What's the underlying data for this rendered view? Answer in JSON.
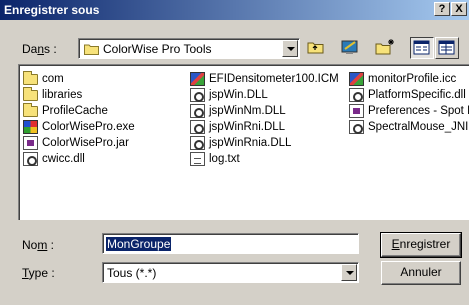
{
  "window": {
    "title": "Enregistrer sous",
    "help_glyph": "?",
    "close_glyph": "X"
  },
  "lookin": {
    "label_prefix": "Da",
    "label_accel": "n",
    "label_suffix": "s :",
    "value": "ColorWise Pro Tools"
  },
  "toolbar": {
    "icons": [
      "up-folder-icon",
      "desktop-icon",
      "new-folder-icon",
      "list-view-icon",
      "details-view-icon"
    ]
  },
  "files": {
    "col1": [
      {
        "name": "com",
        "icon": "folder-icon"
      },
      {
        "name": "libraries",
        "icon": "folder-icon"
      },
      {
        "name": "ProfileCache",
        "icon": "folder-icon"
      },
      {
        "name": "ColorWisePro.exe",
        "icon": "exe-icon"
      },
      {
        "name": "ColorWisePro.jar",
        "icon": "jar-icon"
      },
      {
        "name": "cwicc.dll",
        "icon": "dll-icon"
      }
    ],
    "col2": [
      {
        "name": "EFIDensitometer100.ICM",
        "icon": "icm-icon"
      },
      {
        "name": "jspWin.DLL",
        "icon": "dll-icon"
      },
      {
        "name": "jspWinNm.DLL",
        "icon": "dll-icon"
      },
      {
        "name": "jspWinRni.DLL",
        "icon": "dll-icon"
      },
      {
        "name": "jspWinRnia.DLL",
        "icon": "dll-icon"
      },
      {
        "name": "log.txt",
        "icon": "text-file-icon"
      }
    ],
    "col3": [
      {
        "name": "monitorProfile.icc",
        "icon": "icm-icon"
      },
      {
        "name": "PlatformSpecific.dll",
        "icon": "dll-icon"
      },
      {
        "name": "Preferences - Spot E",
        "icon": "jar-icon"
      },
      {
        "name": "SpectralMouse_JNI",
        "icon": "dll-icon"
      }
    ]
  },
  "filename": {
    "label_prefix": "No",
    "label_accel": "m",
    "label_suffix": " :",
    "value": "MonGroupe"
  },
  "filetype": {
    "label_accel": "T",
    "label_suffix": "ype :",
    "value": "Tous (*.*)"
  },
  "buttons": {
    "save_accel": "E",
    "save_rest": "nregistrer",
    "cancel": "Annuler"
  }
}
